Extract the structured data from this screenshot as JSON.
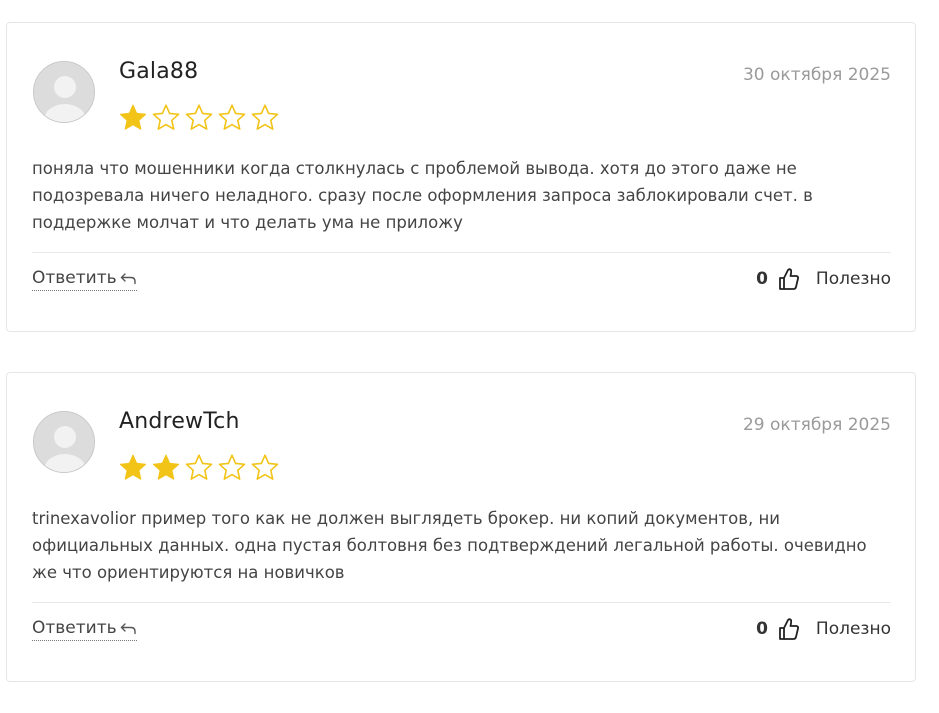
{
  "colors": {
    "star_filled": "#f2c418",
    "star_empty_stroke": "#f2c418",
    "date_text": "#9a9a9a",
    "border": "#e6e6e6"
  },
  "reviews": [
    {
      "author": "Gala88",
      "date": "30 октября 2025",
      "rating": 1,
      "max_rating": 5,
      "text": "поняла что мошенники когда столкнулась с проблемой вывода. хотя до этого даже не подозревала ничего неладного. сразу после оформления запроса заблокировали счет. в поддержке молчат и что делать ума не приложу",
      "reply_label": "Ответить",
      "helpful_count": "0",
      "helpful_label": "Полезно"
    },
    {
      "author": "AndrewTch",
      "date": "29 октября 2025",
      "rating": 2,
      "max_rating": 5,
      "text": "trinexavolior пример того как не должен выглядеть брокер. ни копий документов, ни официальных данных. одна пустая болтовня без подтверждений легальной работы. очевидно же что ориентируются на новичков",
      "reply_label": "Ответить",
      "helpful_count": "0",
      "helpful_label": "Полезно"
    }
  ],
  "icons": {
    "avatar": "user-avatar-icon",
    "star": "star-icon",
    "reply": "reply-arrow-icon",
    "helpful": "thumbs-up-icon"
  }
}
